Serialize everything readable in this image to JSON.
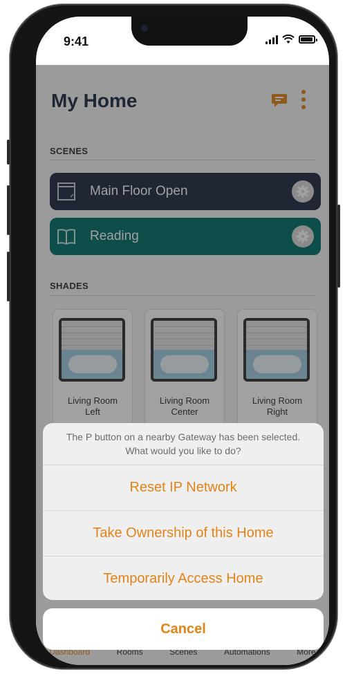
{
  "status_bar": {
    "time": "9:41"
  },
  "header": {
    "title": "My Home"
  },
  "scenes": {
    "label": "SCENES",
    "items": [
      {
        "label": "Main Floor Open",
        "color": "#1F2B44"
      },
      {
        "label": "Reading",
        "color": "#00706B"
      }
    ]
  },
  "shades": {
    "label": "SHADES",
    "items": [
      {
        "line1": "Living Room",
        "line2": "Left"
      },
      {
        "line1": "Living Room",
        "line2": "Center"
      },
      {
        "line1": "Living Room",
        "line2": "Right"
      }
    ]
  },
  "action_sheet": {
    "message": "The P button on a nearby Gateway has been selected. What would you like to do?",
    "actions": [
      "Reset IP Network",
      "Take Ownership of this Home",
      "Temporarily Access Home"
    ],
    "cancel": "Cancel"
  },
  "tabbar": {
    "tabs": [
      "Dashboard",
      "Rooms",
      "Scenes",
      "Automations",
      "More"
    ]
  },
  "colors": {
    "accent": "#E0831A",
    "header_text": "#1F2B44"
  }
}
